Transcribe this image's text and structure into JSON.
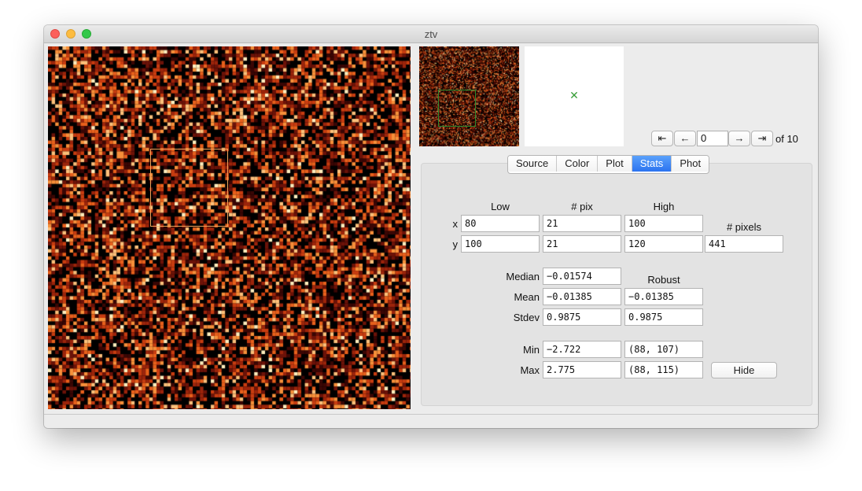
{
  "window": {
    "title": "ztv"
  },
  "image_view": {
    "colormap": [
      "#000000",
      "#3a0604",
      "#6c1208",
      "#9c240b",
      "#c83c10",
      "#e8601c",
      "#f7903a",
      "#fcc07a",
      "#ffeebd"
    ]
  },
  "navigation": {
    "first_icon": "⇤",
    "prev_icon": "←",
    "frame_value": "0",
    "next_icon": "→",
    "last_icon": "⇥",
    "of_label": "of 10"
  },
  "tabs": [
    {
      "label": "Source",
      "active": false
    },
    {
      "label": "Color",
      "active": false
    },
    {
      "label": "Plot",
      "active": false
    },
    {
      "label": "Stats",
      "active": true
    },
    {
      "label": "Phot",
      "active": false
    }
  ],
  "stats": {
    "headers": {
      "low": "Low",
      "npix": "# pix",
      "high": "High",
      "npixels": "# pixels"
    },
    "x": {
      "label": "x",
      "low": "80",
      "npix": "21",
      "high": "100"
    },
    "y": {
      "label": "y",
      "low": "100",
      "npix": "21",
      "high": "120"
    },
    "npixels_value": "441",
    "robust_label": "Robust",
    "median": {
      "label": "Median",
      "value": "−0.01574"
    },
    "mean": {
      "label": "Mean",
      "value": "−0.01385",
      "robust": "−0.01385"
    },
    "stdev": {
      "label": "Stdev",
      "value": "0.9875",
      "robust": "0.9875"
    },
    "min": {
      "label": "Min",
      "value": "−2.722",
      "location": "(88, 107)"
    },
    "max": {
      "label": "Max",
      "value": "2.775",
      "location": "(88, 115)"
    },
    "hide_label": "Hide"
  }
}
